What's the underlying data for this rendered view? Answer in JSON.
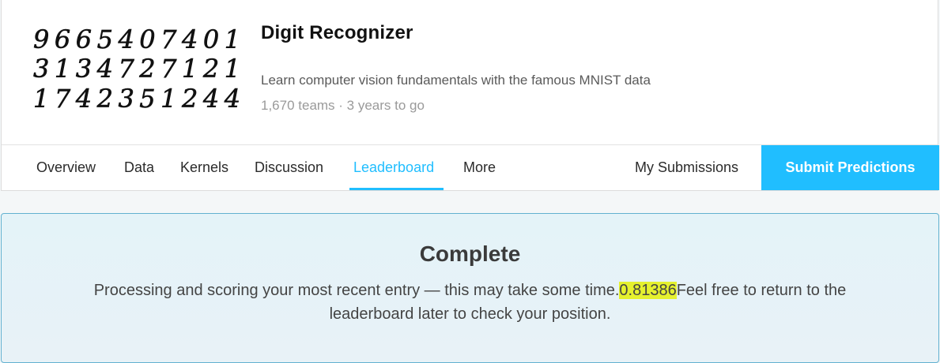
{
  "competition": {
    "title": "Digit Recognizer",
    "description": "Learn computer vision fundamentals with the famous MNIST data",
    "meta": "1,670 teams · 3 years to go",
    "thumbnail_rows": [
      "9665407401",
      "3134727121",
      "1742351244"
    ]
  },
  "tabs": [
    {
      "label": "Overview"
    },
    {
      "label": "Data"
    },
    {
      "label": "Kernels"
    },
    {
      "label": "Discussion"
    },
    {
      "label": "Leaderboard",
      "active": true
    },
    {
      "label": "More"
    }
  ],
  "actions": {
    "my_submissions": "My Submissions",
    "submit": "Submit Predictions"
  },
  "status": {
    "title": "Complete",
    "text_before": "Processing and scoring your most recent entry — this may take some time.",
    "score": "0.81386",
    "text_after": "Feel free to return to the leaderboard later to check your position."
  },
  "colors": {
    "accent": "#20beff",
    "highlight": "#e5f12e"
  }
}
